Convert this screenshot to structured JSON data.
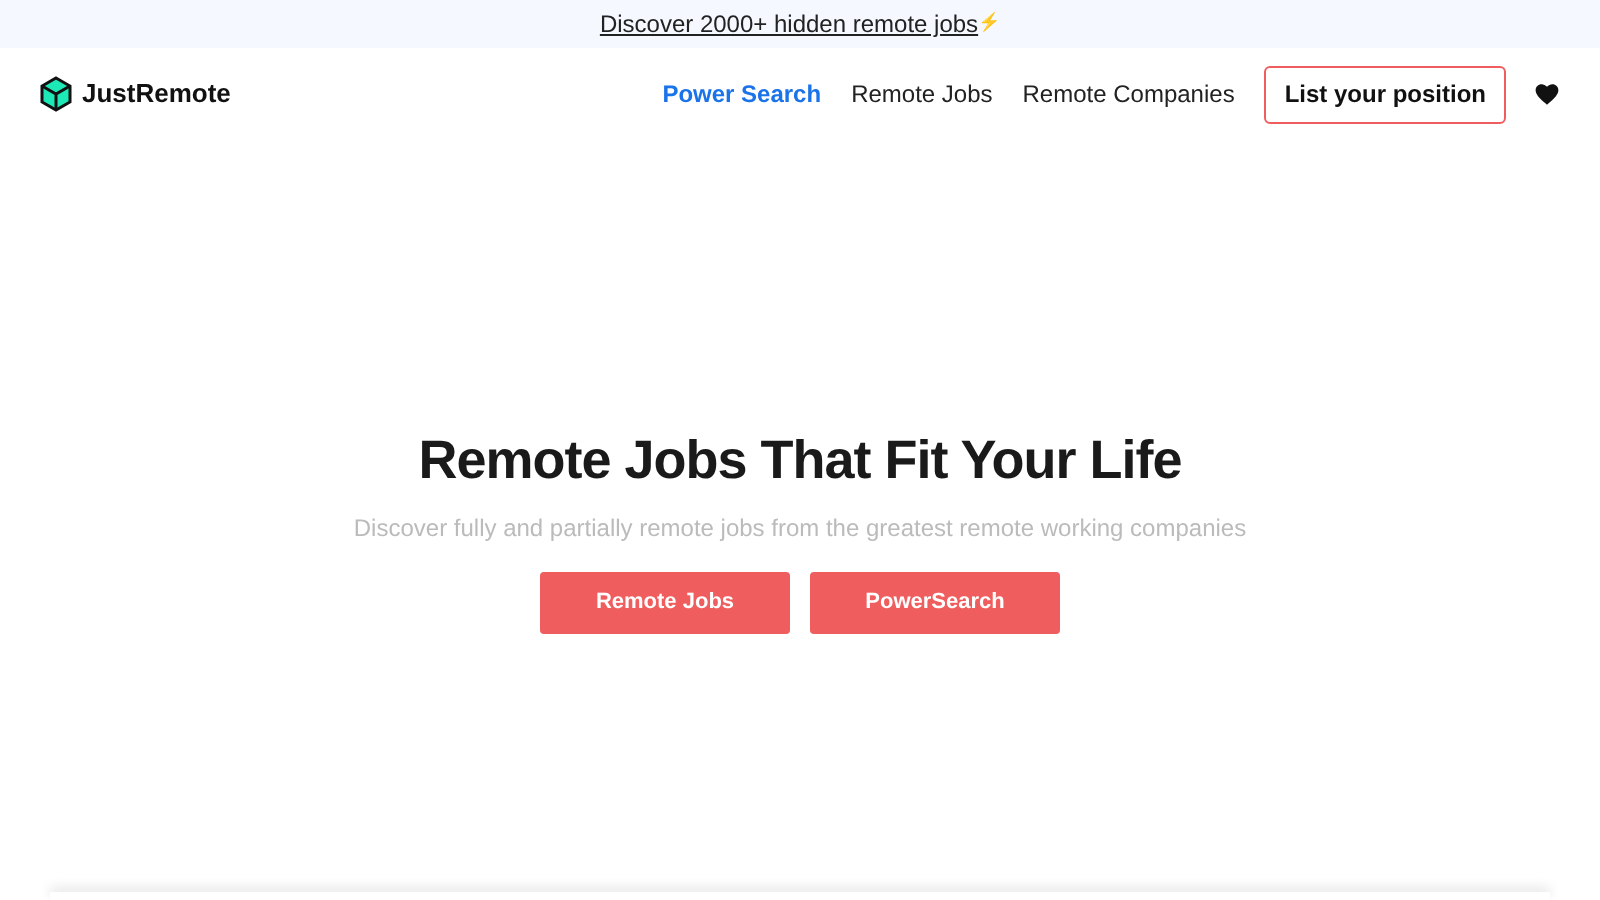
{
  "banner": {
    "link": "Discover 2000+ hidden remote jobs",
    "icon_text": "⚡"
  },
  "header": {
    "logo_text": "JustRemote",
    "nav": [
      {
        "label": "Power Search",
        "selected": true
      },
      {
        "label": "Remote Jobs",
        "selected": false
      },
      {
        "label": "Remote Companies",
        "selected": false
      }
    ],
    "cta": "List your position"
  },
  "hero": {
    "title": "Remote Jobs That Fit Your Life",
    "subtitle": "Discover fully and partially remote jobs from the greatest remote working companies",
    "buttons": [
      "Remote Jobs",
      "PowerSearch"
    ]
  }
}
